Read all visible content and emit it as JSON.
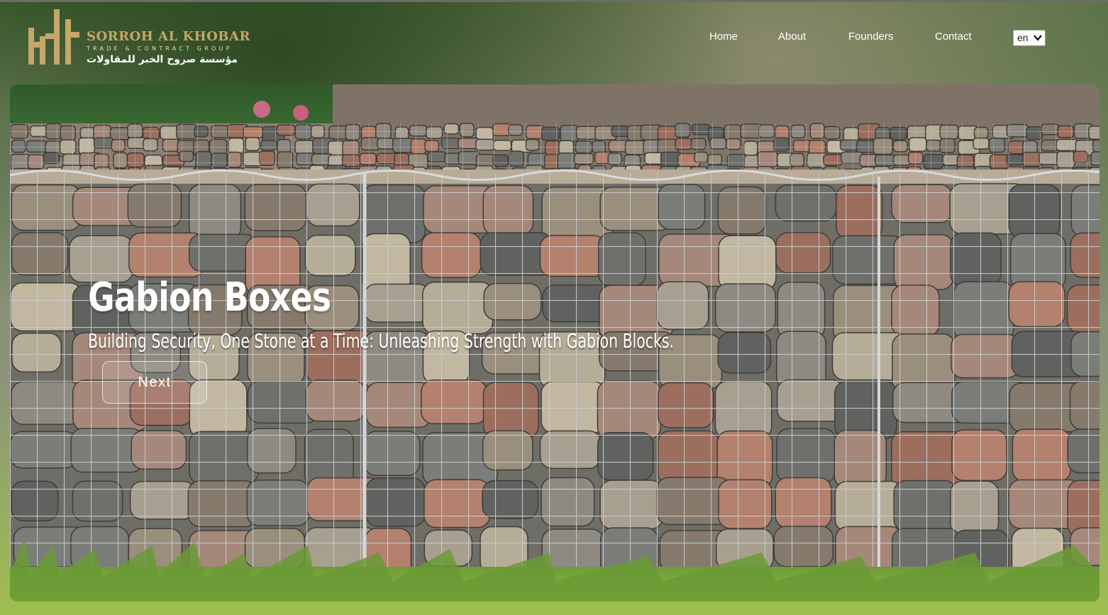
{
  "brand": {
    "name": "SORROH AL KHOBAR",
    "tagline": "TRADE & CONTRACT GROUP",
    "name_ar": "مؤسسة صروح الخبر للمقاولات",
    "gold": "#c6a66a"
  },
  "nav": {
    "items": [
      {
        "label": "Home"
      },
      {
        "label": "About"
      },
      {
        "label": "Founders"
      },
      {
        "label": "Contact"
      }
    ],
    "language": {
      "selected": "en"
    }
  },
  "hero": {
    "title": "Gabion Boxes",
    "subtitle": "Building Security, One Stone at a Time: Unleashing Strength with Gabion Blocks.",
    "button_label": "Next",
    "image": "gabion-stone-wall-photo"
  }
}
